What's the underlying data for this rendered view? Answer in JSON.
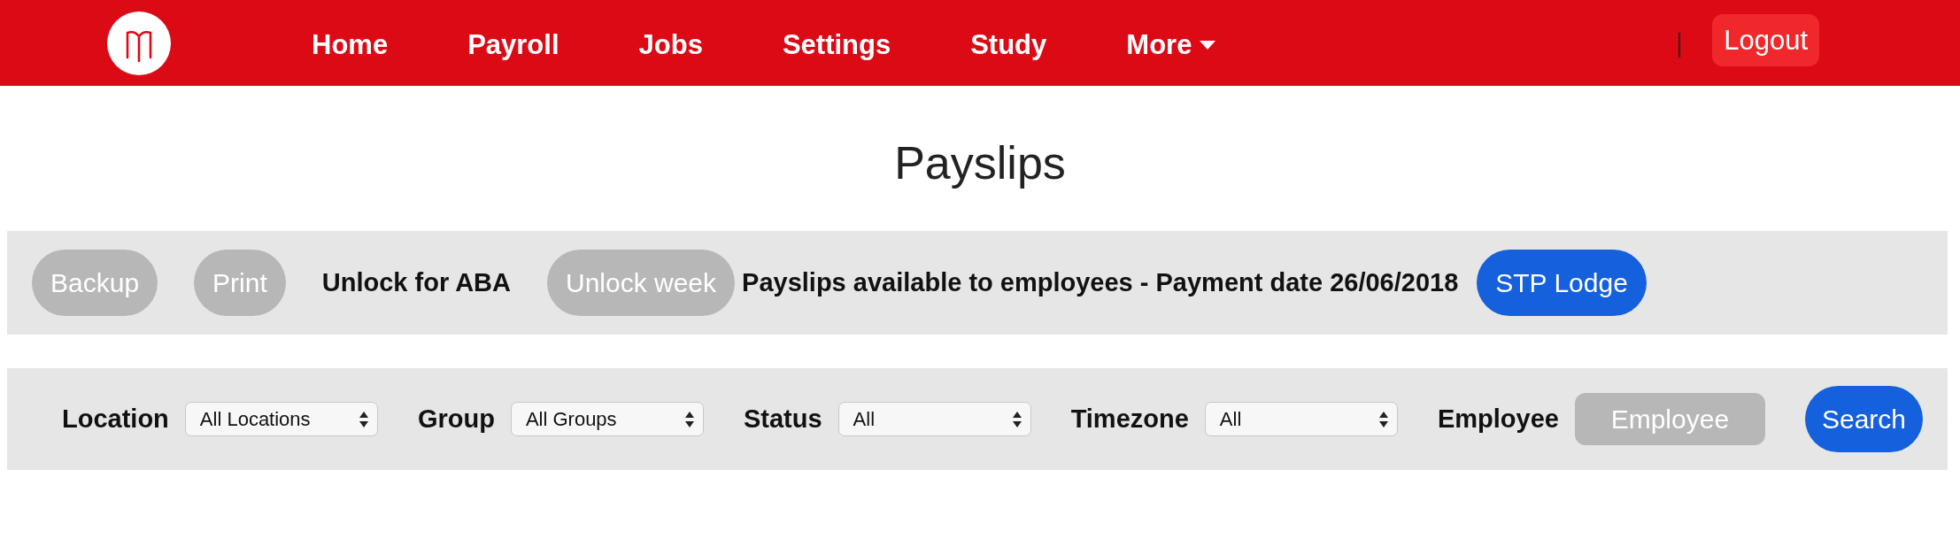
{
  "nav": {
    "items": [
      {
        "label": "Home",
        "dropdown": false
      },
      {
        "label": "Payroll",
        "dropdown": false
      },
      {
        "label": "Jobs",
        "dropdown": false
      },
      {
        "label": "Settings",
        "dropdown": false
      },
      {
        "label": "Study",
        "dropdown": false
      },
      {
        "label": "More",
        "dropdown": true
      }
    ],
    "logout": "Logout"
  },
  "title": "Payslips",
  "toolbar": [
    {
      "kind": "button",
      "label": "Backup",
      "disabled": true
    },
    {
      "kind": "button",
      "label": "Print",
      "disabled": true
    },
    {
      "kind": "link",
      "label": "Unlock for ABA"
    },
    {
      "kind": "button",
      "label": "Unlock week",
      "disabled": true
    },
    {
      "kind": "text",
      "label": "Payslips available to employees - Payment date 26/06/2018"
    },
    {
      "kind": "button",
      "label": "STP Lodge",
      "disabled": false
    }
  ],
  "filters": [
    {
      "label": "Location",
      "value": "All Locations"
    },
    {
      "label": "Group",
      "value": "All Groups"
    },
    {
      "label": "Status",
      "value": "All"
    },
    {
      "label": "Timezone",
      "value": "All"
    }
  ],
  "employee": {
    "label": "Employee",
    "placeholder": "Employee"
  },
  "search_button": {
    "label": "Search"
  }
}
